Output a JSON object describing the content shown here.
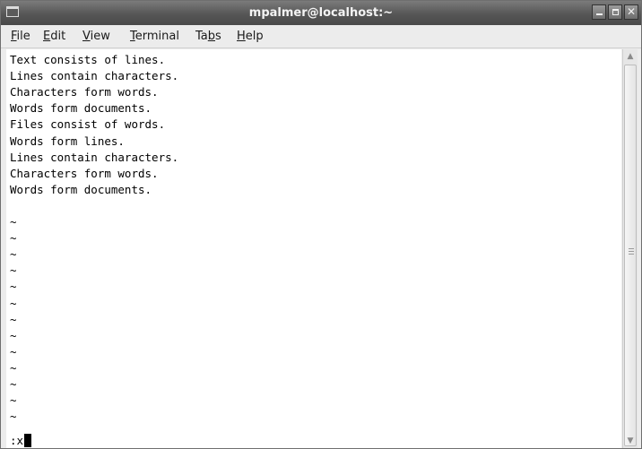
{
  "window": {
    "title": "mpalmer@localhost:~",
    "controls": [
      "minimize",
      "maximize",
      "close"
    ],
    "close_glyph": "✕"
  },
  "menubar": {
    "file": {
      "mnemonic": "F",
      "rest": "ile"
    },
    "edit": {
      "mnemonic": "E",
      "rest": "dit"
    },
    "view": {
      "mnemonic": "V",
      "rest": "iew"
    },
    "terminal": {
      "mnemonic": "T",
      "rest": "erminal"
    },
    "tabs": {
      "before": "Ta",
      "mnemonic": "b",
      "rest": "s"
    },
    "help": {
      "mnemonic": "H",
      "rest": "elp"
    }
  },
  "terminal": {
    "lines": [
      "Text consists of lines.",
      "Lines contain characters.",
      "Characters form words.",
      "Words form documents.",
      "Files consist of words.",
      "Words form lines.",
      "Lines contain characters.",
      "Characters form words.",
      "Words form documents.",
      "",
      "~",
      "~",
      "~",
      "~",
      "~",
      "~",
      "~",
      "~",
      "~",
      "~",
      "~",
      "~",
      "~"
    ],
    "command_line": ":x"
  },
  "scrollbar": {
    "up_arrow": "▲",
    "down_arrow": "▼"
  }
}
